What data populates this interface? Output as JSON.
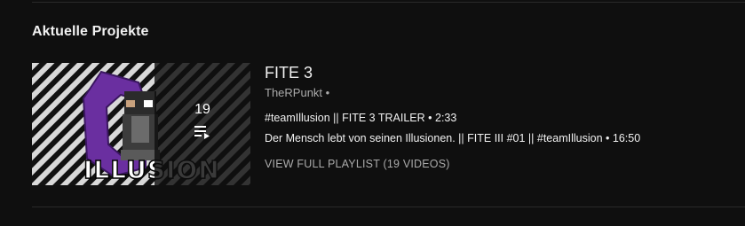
{
  "section": {
    "title": "Aktuelle Projekte"
  },
  "playlist": {
    "title": "FITE 3",
    "channel": "TheRPunkt",
    "channel_separator": "•",
    "video_count_overlay": "19",
    "thumbnail_logo_text": "ILLUSION",
    "videos": [
      {
        "title": "#teamIllusion || FITE 3 TRAILER",
        "separator": "•",
        "duration": "2:33"
      },
      {
        "title": "Der Mensch lebt von seinen Illusionen. || FITE III #01 || #teamIllusion",
        "separator": "•",
        "duration": "16:50"
      }
    ],
    "view_full_label": "VIEW FULL PLAYLIST (19 VIDEOS)"
  },
  "icons": {
    "playlist_queue": "playlist-queue-icon"
  },
  "colors": {
    "background": "#0f0f0f",
    "text_primary": "#f1f1f1",
    "text_secondary": "#aaaaaa",
    "accent_purple": "#7b3fb0",
    "divider": "#2a2a2a"
  }
}
